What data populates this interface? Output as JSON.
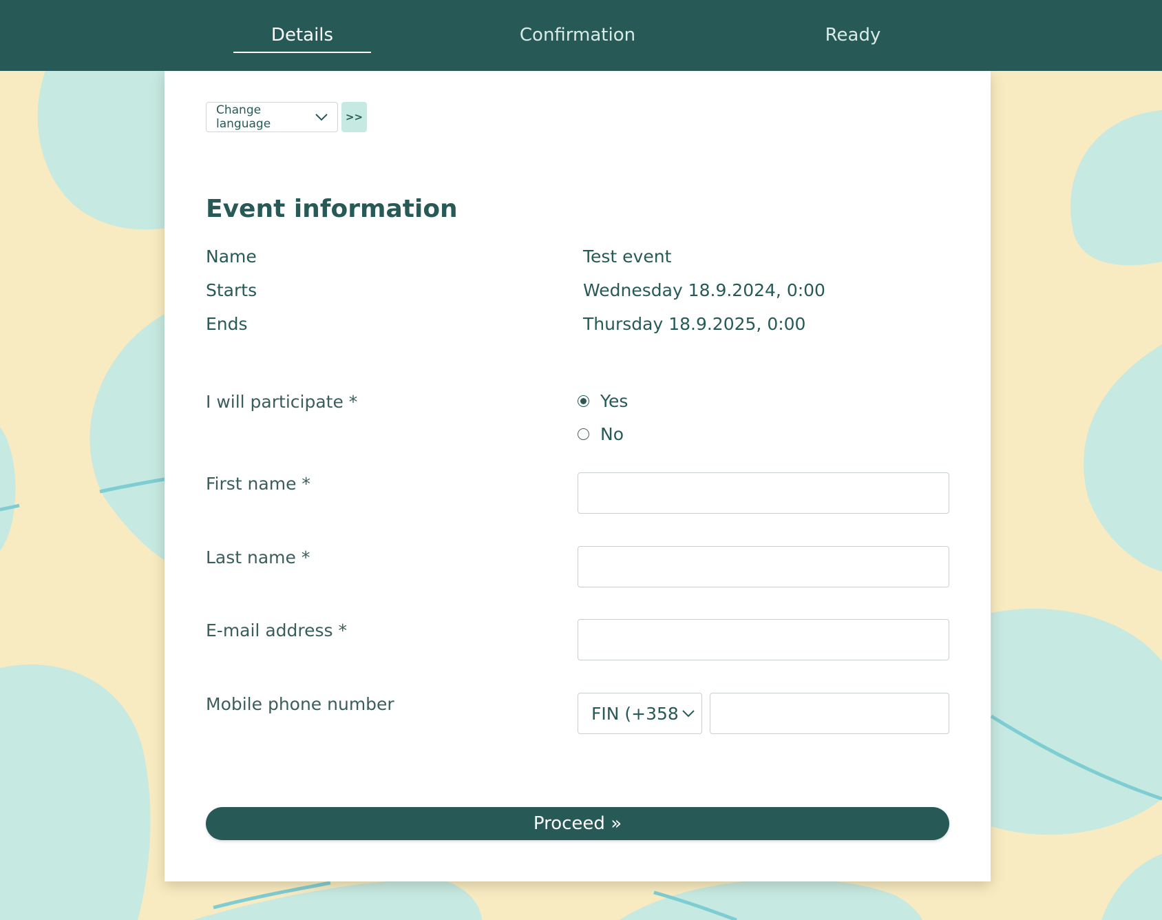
{
  "colors": {
    "primary": "#275a57",
    "background": "#f9ebc1",
    "blob": "#c6e9e1",
    "line": "#7ecdd3",
    "card": "#ffffff"
  },
  "nav": {
    "tabs": [
      {
        "label": "Details",
        "active": true
      },
      {
        "label": "Confirmation",
        "active": false
      },
      {
        "label": "Ready",
        "active": false
      }
    ]
  },
  "language": {
    "select_label": "Change language",
    "go_label": ">>"
  },
  "event": {
    "heading": "Event information",
    "rows": [
      {
        "label": "Name",
        "value": "Test event"
      },
      {
        "label": "Starts",
        "value": "Wednesday 18.9.2024, 0:00"
      },
      {
        "label": "Ends",
        "value": "Thursday 18.9.2025, 0:00"
      }
    ]
  },
  "form": {
    "participate": {
      "label": "I will participate *",
      "options": [
        {
          "label": "Yes",
          "selected": true
        },
        {
          "label": "No",
          "selected": false
        }
      ]
    },
    "first_name": {
      "label": "First name *",
      "value": ""
    },
    "last_name": {
      "label": "Last name *",
      "value": ""
    },
    "email": {
      "label": "E-mail address *",
      "value": ""
    },
    "mobile": {
      "label": "Mobile phone number",
      "country_code": "FIN (+358",
      "value": ""
    },
    "proceed_label": "Proceed »"
  }
}
